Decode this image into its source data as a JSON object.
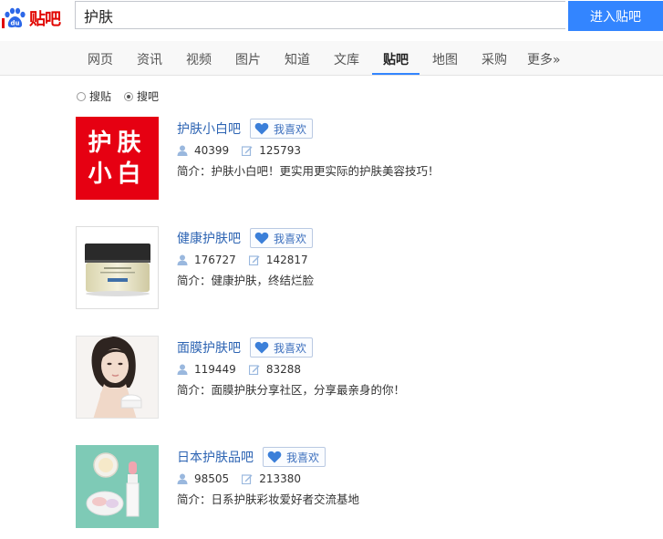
{
  "header": {
    "logo_text": "贴吧",
    "search_value": "护肤",
    "enter_button": "进入贴吧"
  },
  "nav": {
    "tabs": [
      {
        "label": "网页"
      },
      {
        "label": "资讯"
      },
      {
        "label": "视频"
      },
      {
        "label": "图片"
      },
      {
        "label": "知道"
      },
      {
        "label": "文库"
      },
      {
        "label": "贴吧",
        "active": true
      },
      {
        "label": "地图"
      },
      {
        "label": "采购"
      },
      {
        "label": "更多»"
      }
    ]
  },
  "search_mode": {
    "options": [
      {
        "label": "搜贴",
        "checked": false
      },
      {
        "label": "搜吧",
        "checked": true
      }
    ]
  },
  "results": [
    {
      "name": "护肤小白吧",
      "like_label": "我喜欢",
      "members": "40399",
      "posts": "125793",
      "description": "简介：护肤小白吧！更实用更实际的护肤美容技巧！",
      "thumb_text_1": "护肤",
      "thumb_text_2": "小白",
      "thumb_color": "#e60012"
    },
    {
      "name": "健康护肤吧",
      "like_label": "我喜欢",
      "members": "176727",
      "posts": "142817",
      "description": "简介：健康护肤，终结烂脸"
    },
    {
      "name": "面膜护肤吧",
      "like_label": "我喜欢",
      "members": "119449",
      "posts": "83288",
      "description": "简介：面膜护肤分享社区，分享最亲身的你！"
    },
    {
      "name": "日本护肤品吧",
      "like_label": "我喜欢",
      "members": "98505",
      "posts": "213380",
      "description": "简介：日系护肤彩妆爱好者交流基地",
      "thumb_color": "#7ecab6"
    }
  ],
  "colors": {
    "accent": "#3385ff",
    "link": "#2d64b3",
    "brand_red": "#e10601"
  }
}
